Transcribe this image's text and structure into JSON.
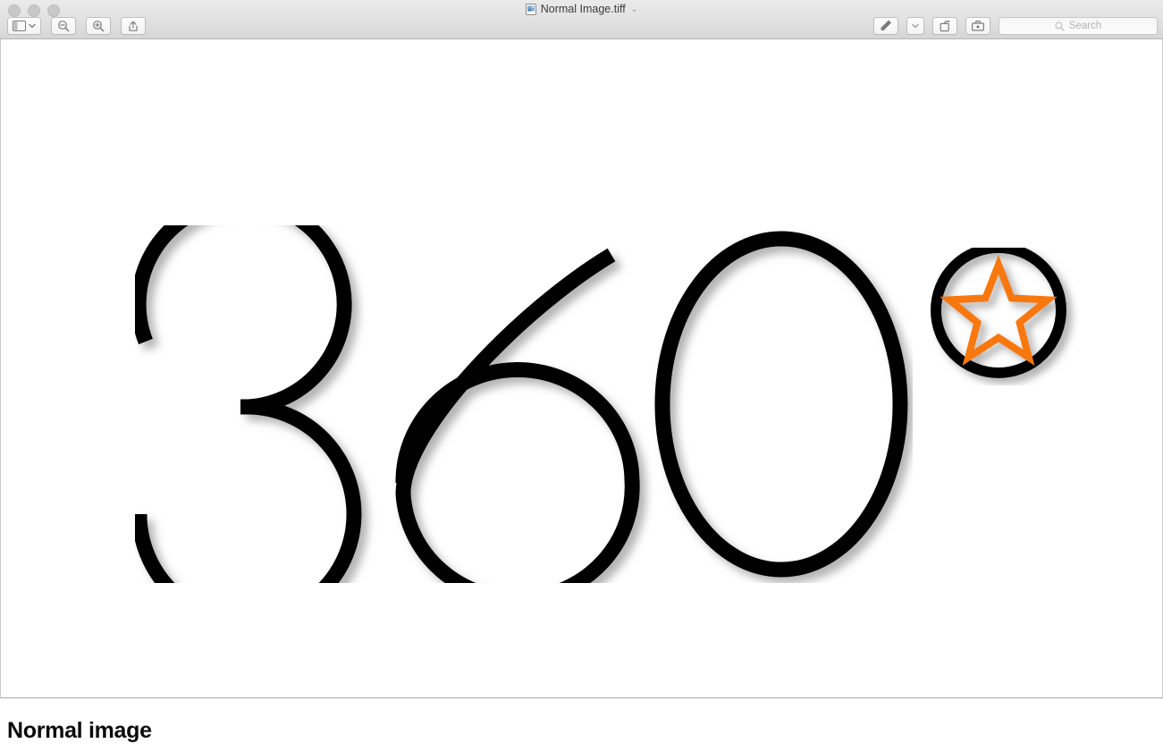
{
  "window": {
    "title": "Normal Image.tiff",
    "title_icon": "document-icon",
    "title_chevron": "⌄",
    "traffic_lights": [
      {
        "name": "close",
        "color": "#c8c8c8"
      },
      {
        "name": "minimize",
        "color": "#c8c8c8"
      },
      {
        "name": "zoom",
        "color": "#c8c8c8"
      }
    ]
  },
  "toolbar": {
    "left_items": [
      {
        "name": "sidebar-toggle-button",
        "icon": "sidebar-icon",
        "has_chevron": true,
        "label": ""
      },
      {
        "name": "zoom-out-button",
        "icon": "magnifier-minus-icon",
        "label": ""
      },
      {
        "name": "zoom-in-button",
        "icon": "magnifier-plus-icon",
        "label": ""
      },
      {
        "name": "share-button",
        "icon": "share-icon",
        "label": ""
      }
    ],
    "right_items": [
      {
        "name": "markup-button",
        "icon": "marker-pen-icon",
        "has_chevron": true,
        "label": ""
      },
      {
        "name": "rotate-button",
        "icon": "rotate-left-icon",
        "label": ""
      },
      {
        "name": "annotate-toolbox-button",
        "icon": "toolbox-icon",
        "label": ""
      }
    ]
  },
  "search": {
    "placeholder": "Search",
    "value": "",
    "icon": "search-icon"
  },
  "artwork": {
    "wordmark_text": "360",
    "wordmark_color": "#000000",
    "shadow_color": "#b0b0b0",
    "badge": {
      "ring_color": "#000000",
      "star_color": "#F87808",
      "star_points": 5
    }
  },
  "caption": {
    "text": "Normal image"
  }
}
